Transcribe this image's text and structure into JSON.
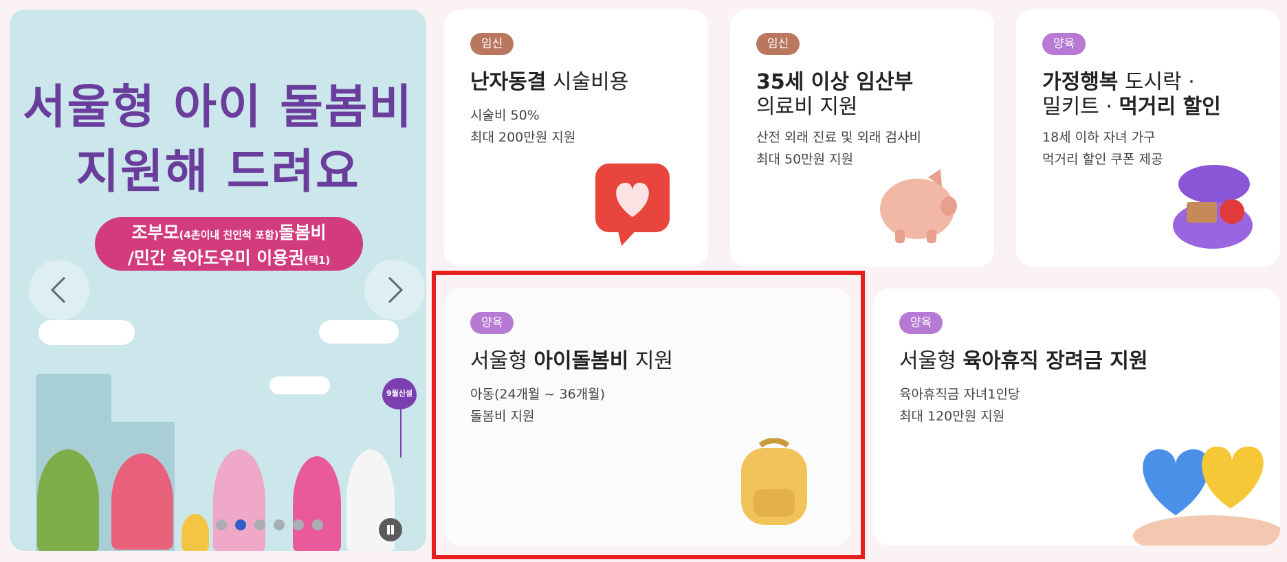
{
  "banner": {
    "title_line1": "서울형 아이 돌봄비",
    "title_line2": "지원해 드려요",
    "pill_line1_a": "조부모",
    "pill_line1_small": "(4촌이내 친인척 포함)",
    "pill_line1_b": "돌봄비",
    "pill_line2_a": "/민간 육아도우미 이용권",
    "pill_line2_small": "(택1)",
    "balloon_text": "9월신설",
    "slide_count": 6,
    "active_slide": 2
  },
  "cards": [
    {
      "tag": "임신",
      "title_bold": "난자동결",
      "title_rest": " 시술비용",
      "title_line2": "",
      "desc1": "시술비 50%",
      "desc2": "최대 200만원 지원",
      "icon": "heart-chat-icon"
    },
    {
      "tag": "임신",
      "title_bold": "35세 이상 임산부",
      "title_rest": "",
      "title_line2": "의료비 지원",
      "desc1": "산전 외래 진료 및 외래 검사비",
      "desc2": "최대 50만원 지원",
      "icon": "piggy-bank-icon"
    },
    {
      "tag": "양육",
      "title_bold": "가정행복",
      "title_rest": " 도시락 ·",
      "title_line2_a": "밀키트 · ",
      "title_line2_b": "먹거리 할인",
      "desc1": "18세 이하 자녀 가구",
      "desc2": "먹거리 할인 쿠폰 제공",
      "icon": "lunchbox-icon"
    },
    {
      "tag": "양육",
      "title_pre": "서울형 ",
      "title_bold": "아이돌봄비",
      "title_rest": " 지원",
      "desc1": "아동(24개월 ~ 36개월)",
      "desc2": "돌봄비 지원",
      "icon": "backpack-icon"
    },
    {
      "tag": "양육",
      "title_pre": "서울형 ",
      "title_bold": "육아휴직 장려금 지원",
      "title_rest": "",
      "desc1": "육아휴직금 자녀1인당",
      "desc2": "최대 120만원 지원",
      "icon": "hearts-in-hands-icon"
    }
  ],
  "colors": {
    "tag_pregnancy": "#b9775f",
    "tag_parenting": "#b679d4",
    "highlight": "#e61e1e",
    "banner_bg": "#cbe7eb"
  }
}
